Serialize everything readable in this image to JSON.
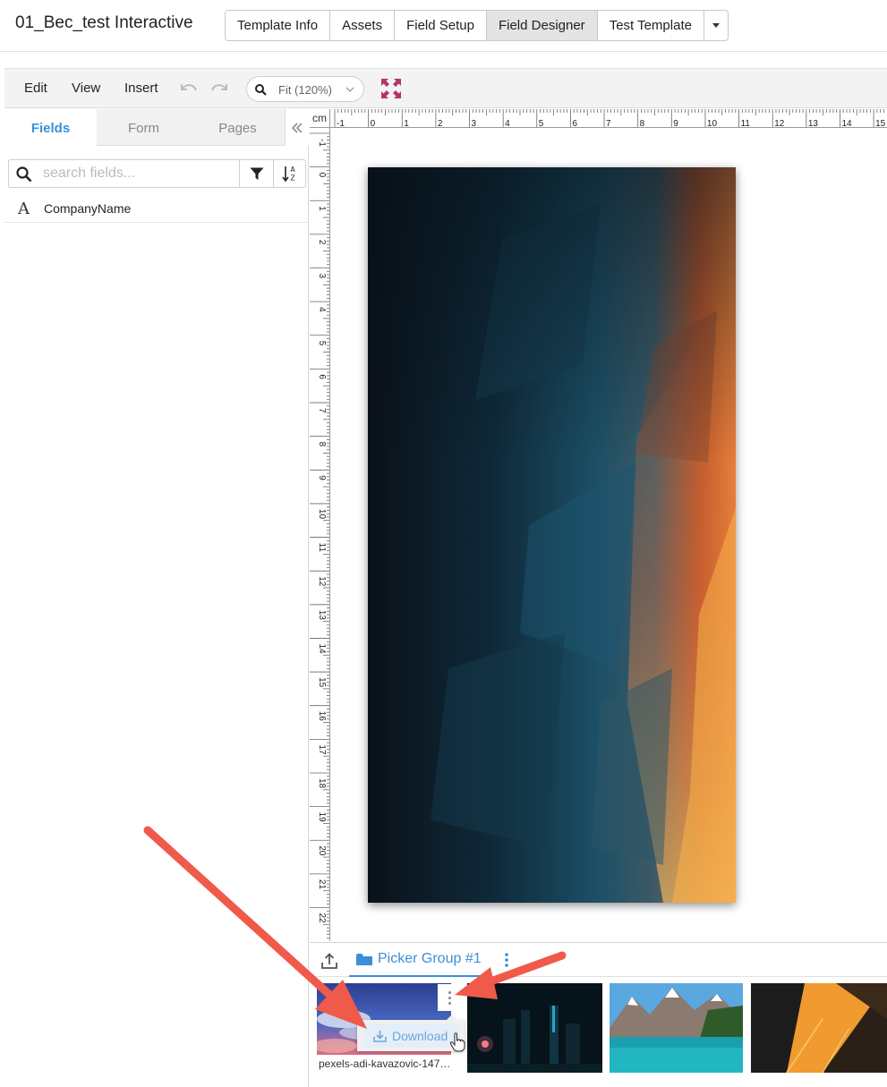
{
  "app": {
    "title": "01_Bec_test Interactive",
    "tabs": [
      {
        "label": "Template Info",
        "active": false
      },
      {
        "label": "Assets",
        "active": false
      },
      {
        "label": "Field Setup",
        "active": false
      },
      {
        "label": "Field Designer",
        "active": true
      },
      {
        "label": "Test Template",
        "active": false
      }
    ]
  },
  "toolbar": {
    "menus": [
      "Edit",
      "View",
      "Insert"
    ],
    "zoom_label": "Fit (120%)",
    "icons": [
      "undo-icon",
      "redo-icon",
      "zoom-icon",
      "fullscreen-icon"
    ]
  },
  "left_panel": {
    "tabs": [
      {
        "label": "Fields",
        "active": true
      },
      {
        "label": "Form",
        "active": false
      },
      {
        "label": "Pages",
        "active": false
      }
    ],
    "search_placeholder": "search fields...",
    "fields": [
      {
        "icon": "A",
        "name": "CompanyName"
      }
    ]
  },
  "canvas": {
    "ruler_unit": "cm",
    "h_ticks": [
      "-1",
      "0",
      "1",
      "2",
      "3",
      "4",
      "5",
      "6",
      "7",
      "8",
      "9",
      "10",
      "11",
      "12",
      "13",
      "14",
      "15"
    ],
    "v_ticks": [
      "-1",
      "0",
      "1",
      "2",
      "3",
      "4",
      "5",
      "6",
      "7",
      "8",
      "9",
      "10",
      "11",
      "12",
      "13",
      "14",
      "15",
      "16",
      "17",
      "18",
      "19",
      "20",
      "21",
      "22",
      "23"
    ]
  },
  "picker": {
    "group_label": "Picker Group #1",
    "selected_thumb_caption": "pexels-adi-kavazovic-147…",
    "menu_item": "Download",
    "thumbnails": [
      "sunset-sky",
      "night-city",
      "mountain-lake",
      "skyscrapers-up"
    ]
  },
  "colors": {
    "accent": "#3a8fd9",
    "annotation_arrow": "#f05a4a",
    "fullscreen_icon": "#b8336a"
  }
}
